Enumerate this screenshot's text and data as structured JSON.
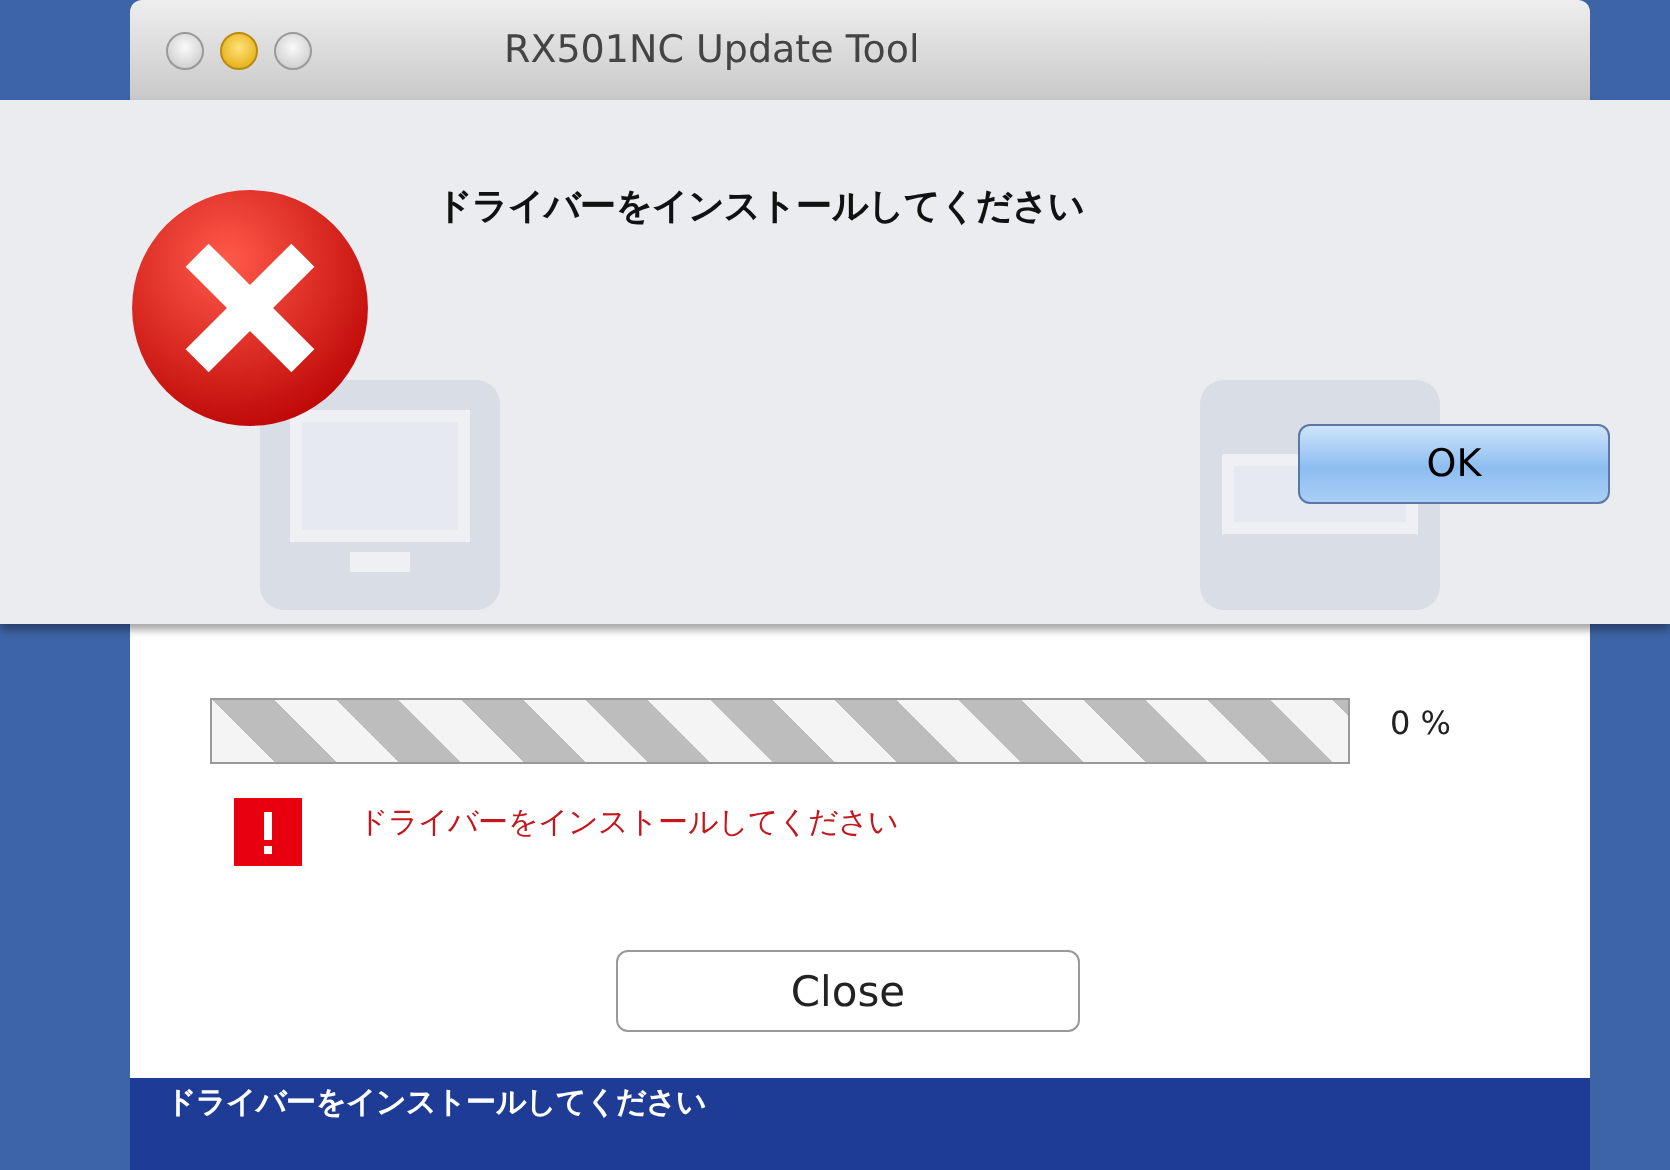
{
  "window": {
    "title": "RX501NC Update Tool"
  },
  "alert": {
    "message": "ドライバーをインストールしてください",
    "buttons": [
      "OK"
    ]
  },
  "progress": {
    "level": 0,
    "reading": "0 %"
  },
  "error_message": "ドライバーをインストールしてください",
  "buttons": [
    "Close"
  ],
  "status_bar": "ドライバーをインストールしてください"
}
